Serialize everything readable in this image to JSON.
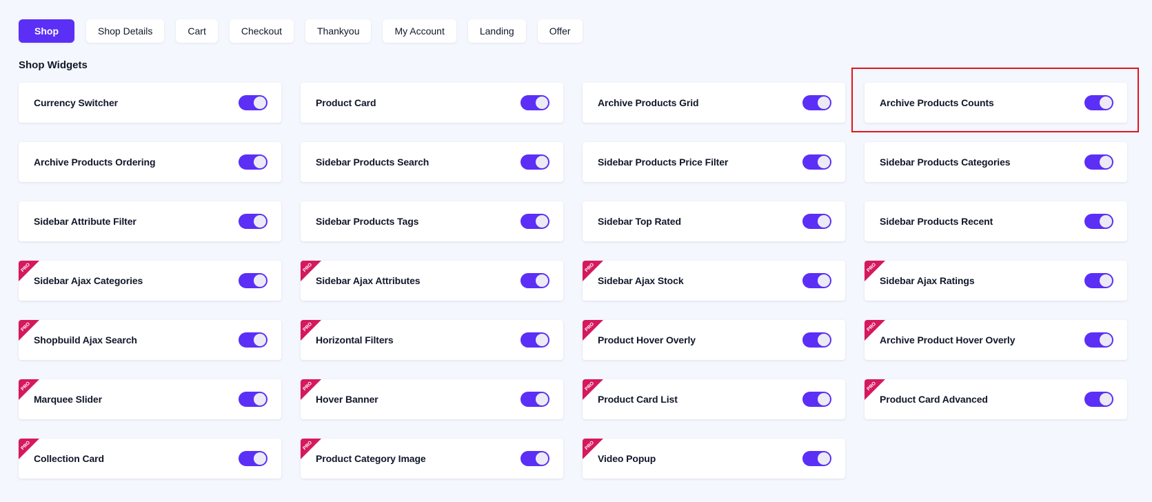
{
  "tabs": [
    {
      "label": "Shop",
      "active": true
    },
    {
      "label": "Shop Details",
      "active": false
    },
    {
      "label": "Cart",
      "active": false
    },
    {
      "label": "Checkout",
      "active": false
    },
    {
      "label": "Thankyou",
      "active": false
    },
    {
      "label": "My Account",
      "active": false
    },
    {
      "label": "Landing",
      "active": false
    },
    {
      "label": "Offer",
      "active": false
    }
  ],
  "section": {
    "title": "Shop Widgets"
  },
  "pro_badge_text": "PRO",
  "colors": {
    "accent": "#5b2ff6",
    "pro_badge": "#d6185d",
    "highlight_border": "#e0141e",
    "page_background": "#f4f7fd"
  },
  "widgets": [
    {
      "label": "Currency Switcher",
      "pro": false,
      "enabled": true
    },
    {
      "label": "Product Card",
      "pro": false,
      "enabled": true
    },
    {
      "label": "Archive Products Grid",
      "pro": false,
      "enabled": true
    },
    {
      "label": "Archive Products Counts",
      "pro": false,
      "enabled": true,
      "highlighted": true
    },
    {
      "label": "Archive Products Ordering",
      "pro": false,
      "enabled": true
    },
    {
      "label": "Sidebar Products Search",
      "pro": false,
      "enabled": true
    },
    {
      "label": "Sidebar Products Price Filter",
      "pro": false,
      "enabled": true
    },
    {
      "label": "Sidebar Products Categories",
      "pro": false,
      "enabled": true
    },
    {
      "label": "Sidebar Attribute Filter",
      "pro": false,
      "enabled": true
    },
    {
      "label": "Sidebar Products Tags",
      "pro": false,
      "enabled": true
    },
    {
      "label": "Sidebar Top Rated",
      "pro": false,
      "enabled": true
    },
    {
      "label": "Sidebar Products Recent",
      "pro": false,
      "enabled": true
    },
    {
      "label": "Sidebar Ajax Categories",
      "pro": true,
      "enabled": true
    },
    {
      "label": "Sidebar Ajax Attributes",
      "pro": true,
      "enabled": true
    },
    {
      "label": "Sidebar Ajax Stock",
      "pro": true,
      "enabled": true
    },
    {
      "label": "Sidebar Ajax Ratings",
      "pro": true,
      "enabled": true
    },
    {
      "label": "Shopbuild Ajax Search",
      "pro": true,
      "enabled": true
    },
    {
      "label": "Horizontal Filters",
      "pro": true,
      "enabled": true
    },
    {
      "label": "Product Hover Overly",
      "pro": true,
      "enabled": true
    },
    {
      "label": "Archive Product Hover Overly",
      "pro": true,
      "enabled": true
    },
    {
      "label": "Marquee Slider",
      "pro": true,
      "enabled": true
    },
    {
      "label": "Hover Banner",
      "pro": true,
      "enabled": true
    },
    {
      "label": "Product Card List",
      "pro": true,
      "enabled": true
    },
    {
      "label": "Product Card Advanced",
      "pro": true,
      "enabled": true
    },
    {
      "label": "Collection Card",
      "pro": true,
      "enabled": true
    },
    {
      "label": "Product Category Image",
      "pro": true,
      "enabled": true
    },
    {
      "label": "Video Popup",
      "pro": true,
      "enabled": true
    }
  ]
}
